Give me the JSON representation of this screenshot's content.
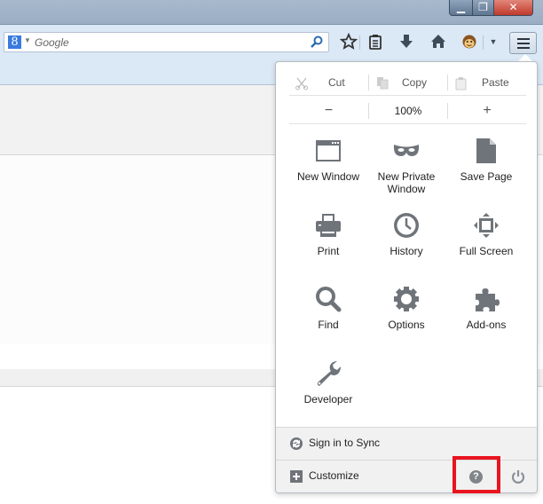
{
  "window": {
    "controls": {
      "minimize": "minimize",
      "restore": "restore",
      "close": "close"
    }
  },
  "navbar": {
    "search": {
      "engine": "Google",
      "engine_logo": "8",
      "placeholder": "Google",
      "value": ""
    },
    "icons": [
      "search-icon",
      "bookmark-star-icon",
      "reading-list-icon",
      "download-icon",
      "home-icon",
      "monkey-addon-icon",
      "dropdown-caret-icon",
      "hamburger-menu-icon"
    ]
  },
  "menu_panel": {
    "edit": {
      "cut": "Cut",
      "copy": "Copy",
      "paste": "Paste"
    },
    "zoom": {
      "minus": "−",
      "level": "100%",
      "plus": "+"
    },
    "items": [
      {
        "label": "New Window",
        "icon": "new-window-icon"
      },
      {
        "label": "New Private Window",
        "icon": "private-mask-icon"
      },
      {
        "label": "Save Page",
        "icon": "save-page-icon"
      },
      {
        "label": "Print",
        "icon": "printer-icon"
      },
      {
        "label": "History",
        "icon": "clock-icon"
      },
      {
        "label": "Full Screen",
        "icon": "fullscreen-icon"
      },
      {
        "label": "Find",
        "icon": "magnifier-icon"
      },
      {
        "label": "Options",
        "icon": "gear-icon"
      },
      {
        "label": "Add-ons",
        "icon": "puzzle-icon"
      },
      {
        "label": "Developer",
        "icon": "wrench-icon"
      }
    ],
    "footer": {
      "sync_label": "Sign in to Sync",
      "customize_label": "Customize",
      "help_icon": "help-icon",
      "quit_icon": "power-icon"
    }
  },
  "annotation": {
    "highlight_color": "#e8141f",
    "highlight_target": "help-button"
  }
}
